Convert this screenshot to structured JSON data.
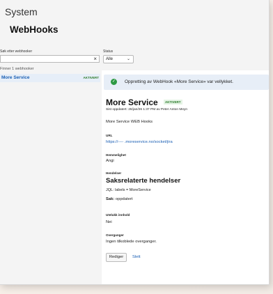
{
  "app": {
    "system_title": "System",
    "page_title": "WebHooks"
  },
  "filters": {
    "search_label": "Søk etter webhooker",
    "search_value": "",
    "clear_icon": "×",
    "status_label": "Status",
    "status_value": "Alle",
    "status_chevron": "⌄"
  },
  "list": {
    "count_text": "Finner 1 webhooker",
    "items": [
      {
        "name": "More Service",
        "status": "AKTIVERT"
      }
    ]
  },
  "toast": {
    "icon": "check-icon",
    "message": "Oppretting av WebHook «More Service» var vellykket."
  },
  "detail": {
    "title": "More Service",
    "badge": "AKTIVERT",
    "updated": "Sist oppdatert: 26/jan/26 1:37 PM av Peter Anton Meyn",
    "description": "More Service WEB Hooks",
    "url_label": "URL",
    "url": "https://---- .moreservice.no/socket/jira",
    "secret_label": "Hemmelighet",
    "secret_value": "Angi",
    "events_label": "Hendelser",
    "events_title": "Saksrelaterte hendelser",
    "jql_text": "JQL: labels = MoreService",
    "issue_prefix": "Sak:",
    "issue_value": "oppdatert",
    "exclude_label": "Utelukk innhold",
    "exclude_value": "Nei",
    "transitions_label": "Overganger",
    "transitions_value": "Ingen tilkoblede overganger.",
    "edit_label": "Rediger",
    "delete_label": "Slett"
  },
  "colors": {
    "accent": "#1a5fb4",
    "success": "#2e9a44",
    "toast_bg": "#e7eef7"
  }
}
